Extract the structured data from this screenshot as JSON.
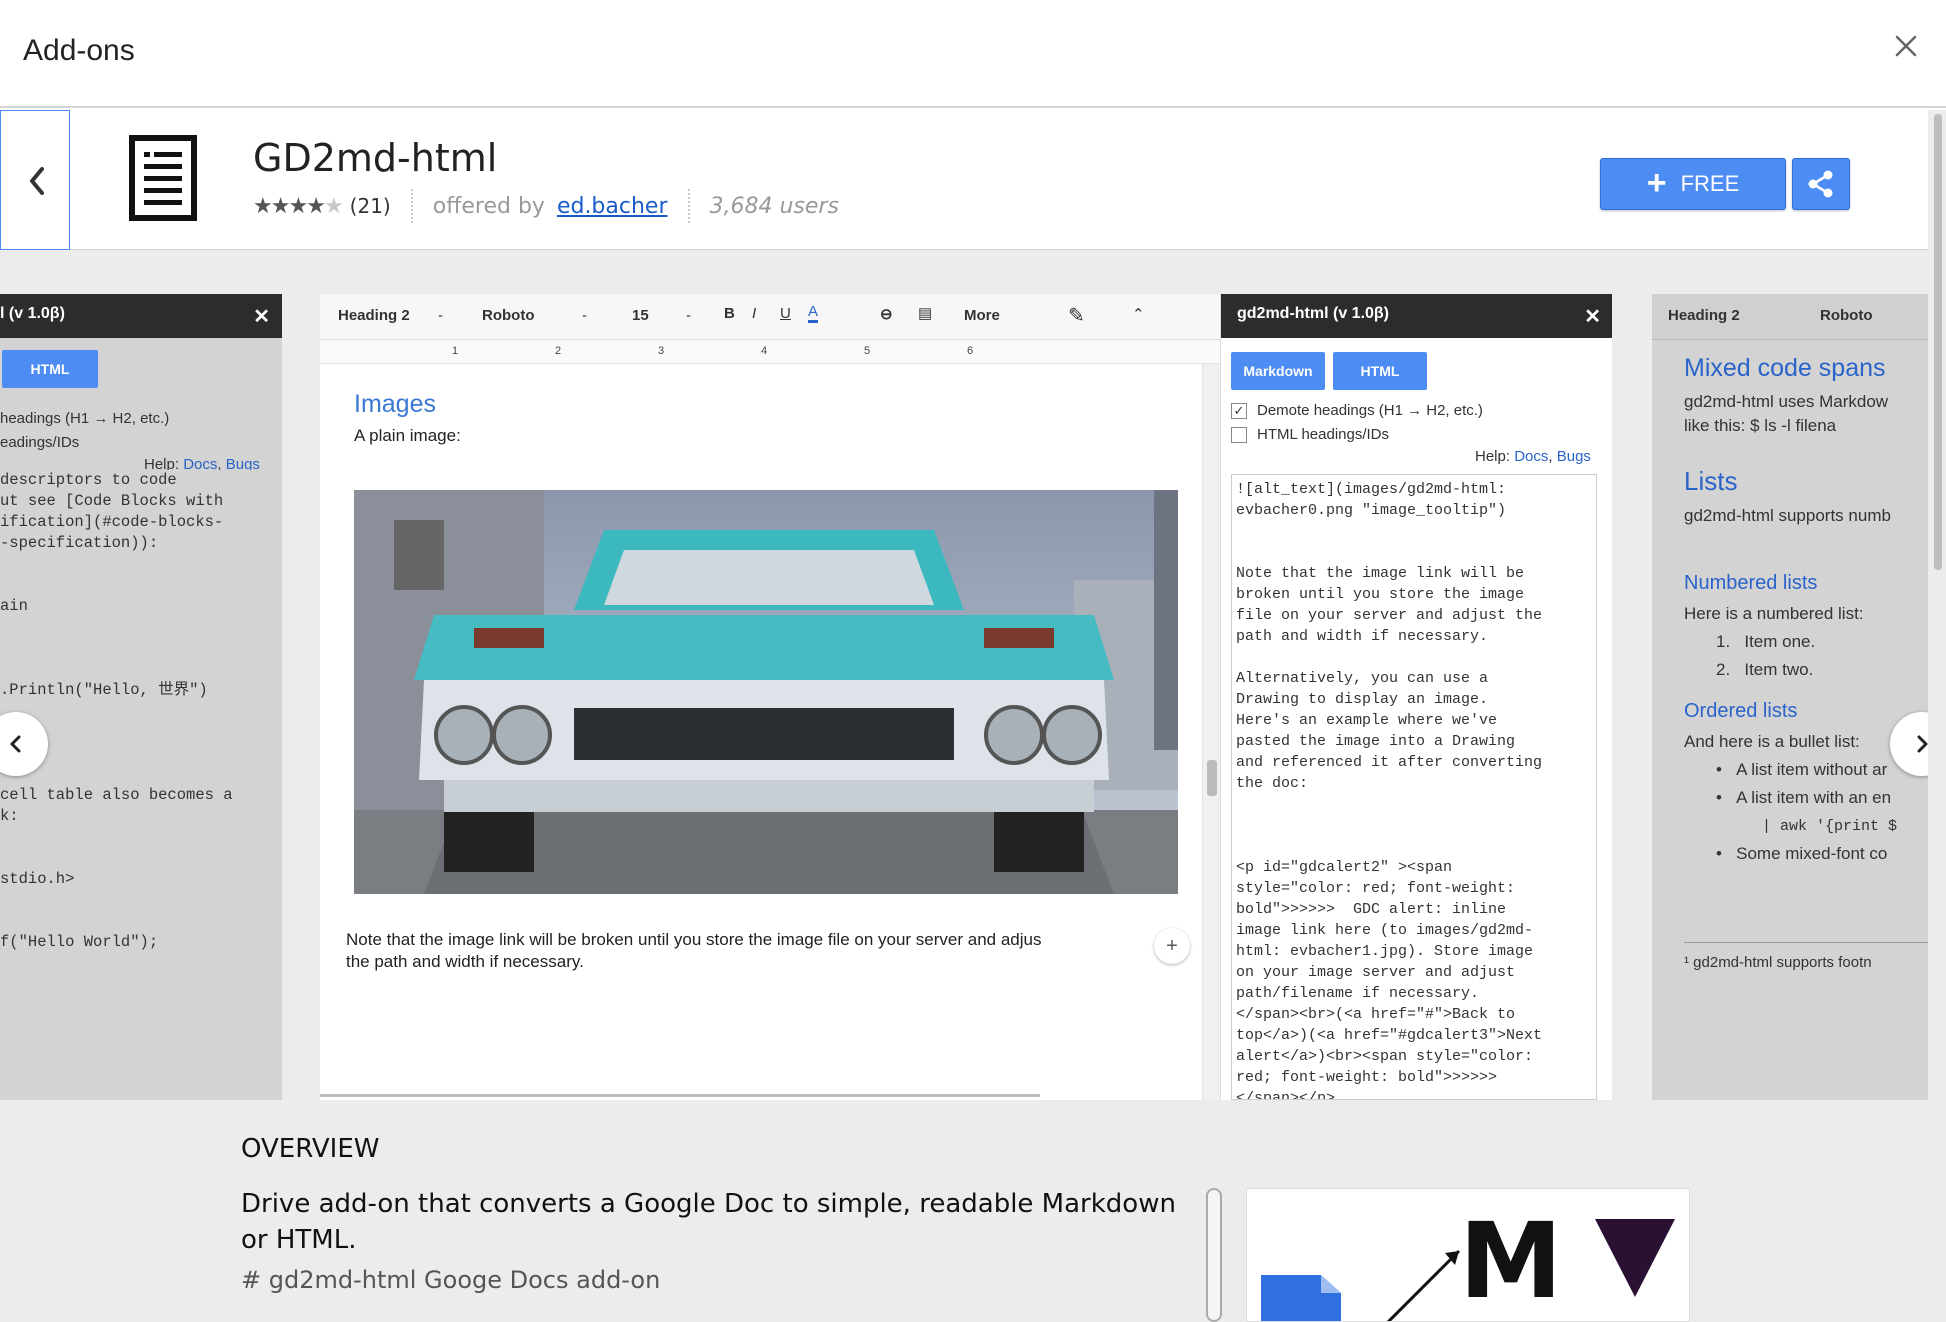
{
  "dialog": {
    "title": "Add-ons",
    "close_icon": "close-icon"
  },
  "app": {
    "name": "GD2md-html",
    "rating": 4,
    "rating_max": 5,
    "rating_count": "(21)",
    "offered_by_label": "offered by",
    "developer": "ed.bacher",
    "users": "3,684 users",
    "free_label": "FREE",
    "icons": {
      "back": "chevron-left-icon",
      "app": "document-icon",
      "plus": "plus-icon",
      "share": "share-icon"
    }
  },
  "colors": {
    "accent": "#4d8cf2",
    "link": "#1a5ac9",
    "header_bar": "#2c2c2c",
    "background": "#ececec"
  },
  "gallery": {
    "left_shot": {
      "panel_title": "l (v 1.0β)",
      "html_button": "HTML",
      "options": [
        "headings (H1 → H2, etc.)",
        "eadings/IDs"
      ],
      "help_label": "Help:",
      "help_docs": "Docs",
      "help_bugs": "Bugs",
      "code_lines": [
        "descriptors to code",
        "ut see [Code Blocks with",
        "ification](#code-blocks-",
        "-specification)):",
        "",
        "",
        "ain",
        "",
        "",
        "",
        ".Println(\"Hello, 世界\")",
        "",
        "",
        "",
        "",
        "cell table also becomes a",
        "k:",
        "",
        "",
        "stdio.h>",
        "",
        "",
        "f(\"Hello World\");"
      ]
    },
    "main_shot": {
      "toolbar": {
        "style": "Heading 2",
        "font": "Roboto",
        "size": "15",
        "bold": "B",
        "italic": "I",
        "underline": "U",
        "text_color": "A",
        "more": "More"
      },
      "ruler_numbers": [
        "1",
        "2",
        "3",
        "4",
        "5",
        "6"
      ],
      "doc_heading": "Images",
      "doc_subtext": "A plain image:",
      "doc_footer": "Note that the image link will be broken until you store the image file on your server and adjus",
      "doc_footer_2": "the path and width if necessary.",
      "panel": {
        "title": "gd2md-html (v 1.0β)",
        "tab_markdown": "Markdown",
        "tab_html": "HTML",
        "option_demote": "Demote headings (H1 → H2, etc.)",
        "option_demote_checked": true,
        "option_html_ids": "HTML headings/IDs",
        "option_html_ids_checked": false,
        "help_label": "Help:",
        "help_docs": "Docs",
        "help_bugs": "Bugs",
        "output_lines": [
          "![alt_text](images/gd2md-html:",
          "evbacher0.png \"image_tooltip\")",
          "",
          "",
          "Note that the image link will be",
          "broken until you store the image",
          "file on your server and adjust the",
          "path and width if necessary.",
          "",
          "Alternatively, you can use a",
          "Drawing to display an image.",
          "Here's an example where we've",
          "pasted the image into a Drawing",
          "and referenced it after converting",
          "the doc:",
          "",
          "",
          "",
          "<p id=\"gdcalert2\" ><span",
          "style=\"color: red; font-weight:",
          "bold\">>>>>>  GDC alert: inline",
          "image link here (to images/gd2md-",
          "html: evbacher1.jpg). Store image",
          "on your image server and adjust",
          "path/filename if necessary.",
          "</span><br>(<a href=\"#\">Back to",
          "top</a>)(<a href=\"#gdcalert3\">Next",
          "alert</a>)<br><span style=\"color:",
          "red; font-weight: bold\">>>>>>",
          "</span></p>"
        ]
      }
    },
    "right_shot": {
      "toolbar_style": "Heading 2",
      "toolbar_font": "Roboto",
      "h_mixed": "Mixed code spans",
      "p_mixed_1": "gd2md-html uses Markdow",
      "p_mixed_2": "like this: $ ls -l filena",
      "h_lists": "Lists",
      "p_lists": "gd2md-html supports numb",
      "h_numbered": "Numbered lists",
      "p_numbered": "Here is a numbered list:",
      "numbered_items": [
        "1.   Item one.",
        "2.   Item two."
      ],
      "h_ordered": "Ordered lists",
      "p_ordered": "And here is a bullet list:",
      "bullet_items": [
        "A list item without ar",
        "A list item with an en",
        "Some mixed-font co"
      ],
      "code_sample": "| awk '{print $",
      "footnote": "¹ gd2md-html supports footn"
    },
    "prev_icon": "chevron-left-icon",
    "next_icon": "chevron-right-icon"
  },
  "overview": {
    "heading": "OVERVIEW",
    "description": "Drive add-on that converts a Google Doc to simple, readable Markdown or HTML.",
    "readme_start": "# gd2md-html Googe Docs add-on",
    "image_letter": "M"
  }
}
